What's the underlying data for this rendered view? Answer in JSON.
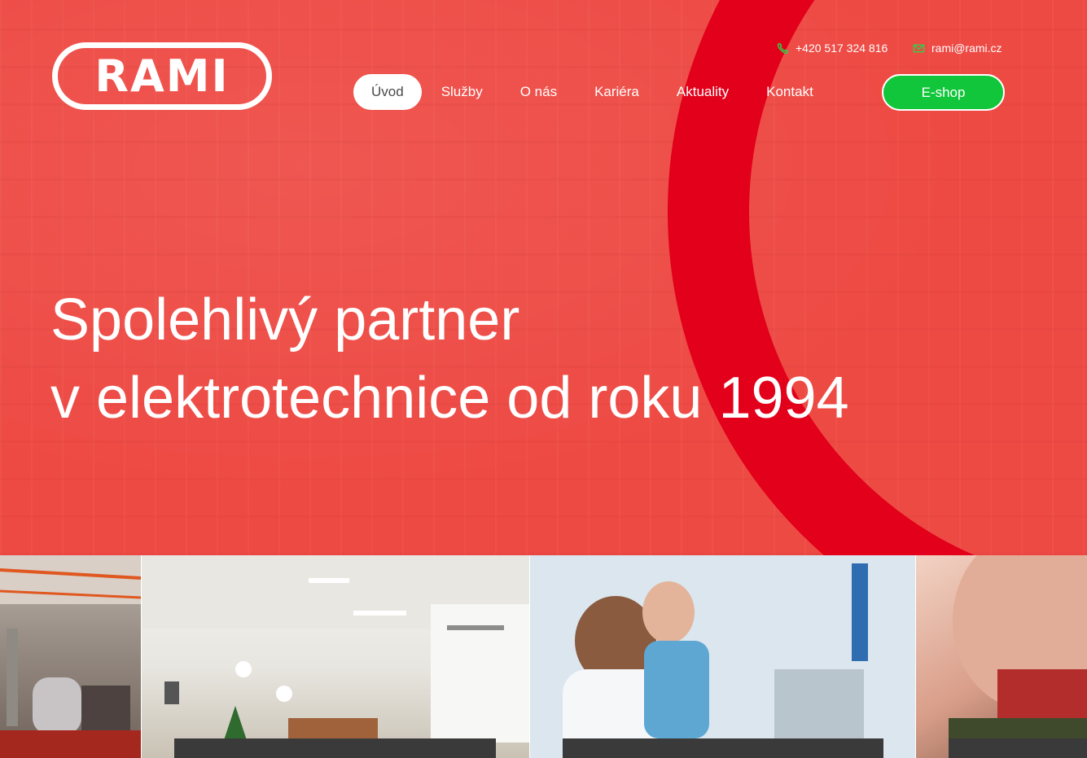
{
  "brand": {
    "logo_text": "RAMI",
    "color": "#e2001a"
  },
  "contacts": {
    "phone": {
      "icon": "phone-icon",
      "text": "+420 517 324 816"
    },
    "email": {
      "icon": "envelope-icon",
      "text": "rami@rami.cz"
    }
  },
  "nav": {
    "items": [
      {
        "label": "Úvod",
        "active": true
      },
      {
        "label": "Služby"
      },
      {
        "label": "O nás"
      },
      {
        "label": "Kariéra"
      },
      {
        "label": "Aktuality"
      },
      {
        "label": "Kontakt"
      }
    ],
    "eshop_label": "E-shop",
    "eshop_color": "#11c63a"
  },
  "hero": {
    "line1": "Spolehlivý partner",
    "line2": "v elektrotechnice od roku 1994"
  },
  "colors": {
    "hero_bg": "#ee4a44",
    "accent_ring": "#e2001a"
  }
}
